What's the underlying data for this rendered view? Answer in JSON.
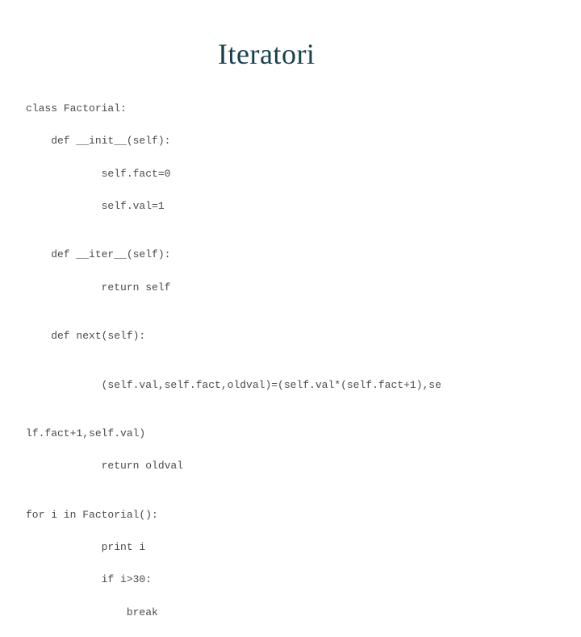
{
  "title": "Iteratori",
  "code": {
    "l1": "class Factorial:",
    "l2": "    def __init__(self):",
    "l3": "            self.fact=0",
    "l4": "            self.val=1",
    "l5": "",
    "l6": "    def __iter__(self):",
    "l7": "            return self",
    "l8": "",
    "l9": "    def next(self):",
    "l10": "",
    "l11": "            (self.val,self.fact,oldval)=(self.val*(self.fact+1),se",
    "l12": "",
    "l13": "lf.fact+1,self.val)",
    "l14": "            return oldval",
    "l15": "",
    "l16": "for i in Factorial():",
    "l17": "            print i",
    "l18": "            if i>30:",
    "l19": "                break"
  }
}
